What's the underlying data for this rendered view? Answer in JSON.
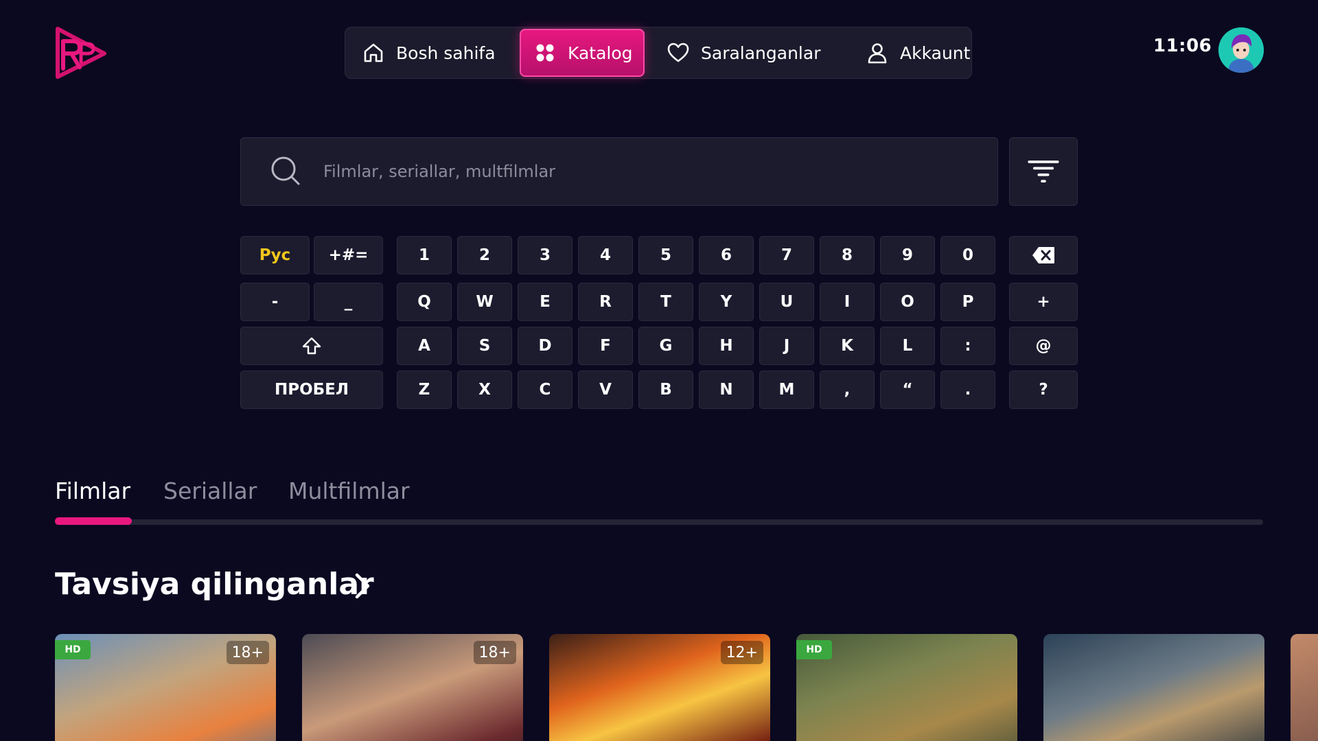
{
  "header": {
    "clock": "11:06",
    "nav": [
      {
        "label": "Bosh sahifa",
        "icon": "home-icon"
      },
      {
        "label": "Katalog",
        "icon": "grid-icon",
        "active": true
      },
      {
        "label": "Saralanganlar",
        "icon": "heart-icon"
      },
      {
        "label": "Akkaunt",
        "icon": "user-icon"
      }
    ]
  },
  "search": {
    "placeholder": "Filmlar, seriallar, multfilmlar"
  },
  "keyboard": {
    "row1": [
      "Рус",
      "+#=",
      "1",
      "2",
      "3",
      "4",
      "5",
      "6",
      "7",
      "8",
      "9",
      "0"
    ],
    "row2": [
      "-",
      "_",
      "Q",
      "W",
      "E",
      "R",
      "T",
      "Y",
      "U",
      "I",
      "O",
      "P",
      "+"
    ],
    "row3": [
      "A",
      "S",
      "D",
      "F",
      "G",
      "H",
      "J",
      "K",
      "L",
      ":",
      "@"
    ],
    "row4": [
      "ПРОБЕЛ",
      "Z",
      "X",
      "C",
      "V",
      "B",
      "N",
      "M",
      ",",
      "“",
      ".",
      "?"
    ]
  },
  "tabs": [
    {
      "label": "Filmlar",
      "active": true
    },
    {
      "label": "Seriallar"
    },
    {
      "label": "Multfilmlar"
    }
  ],
  "section": {
    "title": "Tavsiya qilinganlar"
  },
  "cards": [
    {
      "hd": "HD",
      "age": "18+"
    },
    {
      "age": "18+"
    },
    {
      "age": "12+"
    },
    {
      "hd": "HD"
    },
    {}
  ],
  "colors": {
    "accent": "#e8187f",
    "background": "#0a0920",
    "key": "#1d1c2f",
    "lang_key": "#f2c71c",
    "hd_badge": "#3aa83f"
  }
}
